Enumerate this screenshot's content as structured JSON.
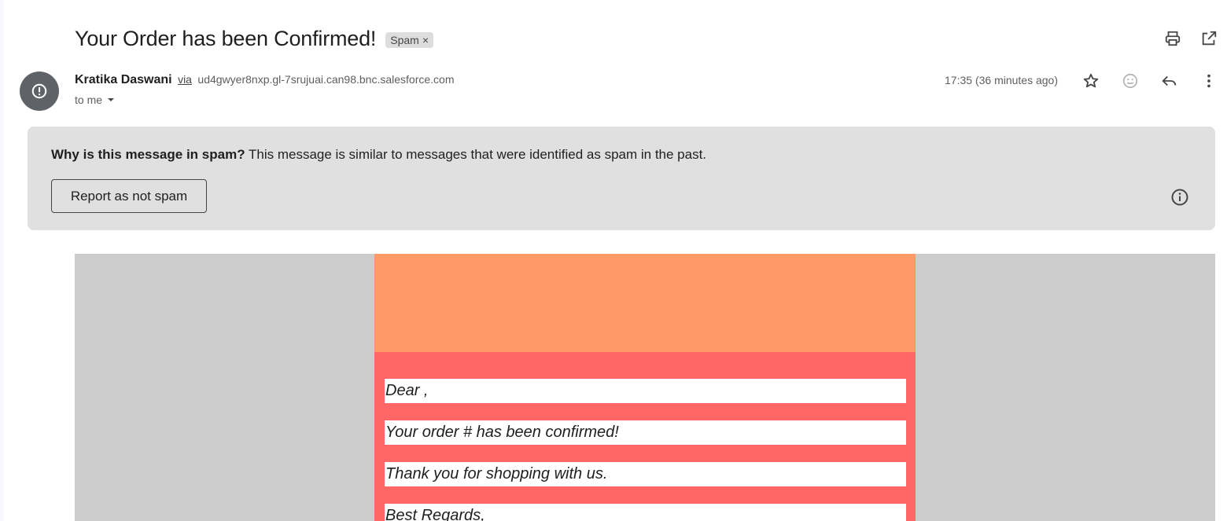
{
  "subject": {
    "title": "Your Order has been Confirmed!",
    "label": "Spam",
    "label_close": "×"
  },
  "sender": {
    "name": "Kratika Daswani",
    "via": "via",
    "address": "ud4gwyer8nxp.gl-7srujuai.can98.bnc.salesforce.com",
    "to": "to me",
    "timestamp": "17:35 (36 minutes ago)"
  },
  "spam_banner": {
    "question": "Why is this message in spam?",
    "explanation": " This message is similar to messages that were identified as spam in the past.",
    "report_button": "Report as not spam"
  },
  "email_body": {
    "lines": [
      "Dear ,",
      "Your order # has been confirmed!",
      "Thank you for shopping with us.",
      "Best Regards,"
    ]
  },
  "icons": {
    "print": "print-icon",
    "open_new_window": "open-in-new-window-icon",
    "avatar": "warning-icon",
    "star": "star-icon",
    "emoji": "emoji-icon",
    "reply": "reply-icon",
    "more": "more-vert-icon",
    "info": "info-icon"
  },
  "colors": {
    "banner_bg": "#e0e0e0",
    "body_bg": "#cccccc",
    "card_header": "#ff9966",
    "card_body": "#ff6666"
  }
}
